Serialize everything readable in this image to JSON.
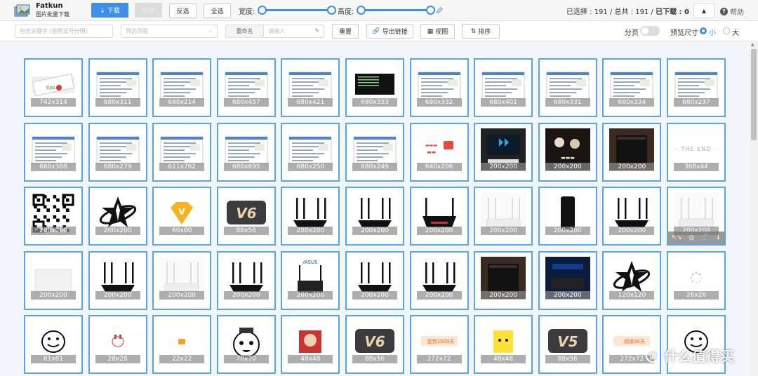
{
  "app": {
    "title": "Fatkun",
    "subtitle": "图片批量下载"
  },
  "toolbar": {
    "download": "↓ 下载",
    "pause": "暂停",
    "invert": "反选",
    "select_all": "全选",
    "width_label": "宽度:",
    "height_label": "高度:",
    "status_prefix": "已选择 : 191 / 总共 : 191 /",
    "status_downloaded": "已下载 : 0",
    "help": "帮助"
  },
  "filters": {
    "keyword_placeholder": "包含关键字 (使用逗号分隔)",
    "page_filter": "筛选页面",
    "rename": "重命名",
    "rename_placeholder": "请输入",
    "reset": "重置",
    "export_links": "导出链接",
    "view": "视图",
    "sort": "排序",
    "paging": "分页",
    "preview_size": "预览尺寸",
    "small": "小",
    "large": "大"
  },
  "tiles": [
    {
      "size": "742x314",
      "kind": "banner"
    },
    {
      "size": "680x311",
      "kind": "doc"
    },
    {
      "size": "680x214",
      "kind": "doc"
    },
    {
      "size": "680x457",
      "kind": "doc"
    },
    {
      "size": "680x421",
      "kind": "doc"
    },
    {
      "size": "680x333",
      "kind": "dark"
    },
    {
      "size": "680x332",
      "kind": "doc"
    },
    {
      "size": "680x401",
      "kind": "doc"
    },
    {
      "size": "680x331",
      "kind": "doc"
    },
    {
      "size": "680x334",
      "kind": "doc"
    },
    {
      "size": "680x237",
      "kind": "doc"
    },
    {
      "size": "680x388",
      "kind": "doc"
    },
    {
      "size": "680x279",
      "kind": "doc"
    },
    {
      "size": "611x762",
      "kind": "doc"
    },
    {
      "size": "680x695",
      "kind": "doc"
    },
    {
      "size": "680x250",
      "kind": "doc"
    },
    {
      "size": "680x249",
      "kind": "doc"
    },
    {
      "size": "640x206",
      "kind": "promo"
    },
    {
      "size": "200x200",
      "kind": "tv"
    },
    {
      "size": "200x200",
      "kind": "poster"
    },
    {
      "size": "200x200",
      "kind": "router-box"
    },
    {
      "size": "368x44",
      "kind": "theend",
      "text": "THE END"
    },
    {
      "size": "200x200",
      "kind": "qr"
    },
    {
      "size": "200x200",
      "kind": "star"
    },
    {
      "size": "60x60",
      "kind": "vgem"
    },
    {
      "size": "88x56",
      "kind": "v6",
      "text": "V6"
    },
    {
      "size": "200x200",
      "kind": "router"
    },
    {
      "size": "200x200",
      "kind": "router"
    },
    {
      "size": "200x200",
      "kind": "router-red"
    },
    {
      "size": "200x200",
      "kind": "router-white"
    },
    {
      "size": "200x200",
      "kind": "tower"
    },
    {
      "size": "200x200",
      "kind": "router"
    },
    {
      "size": "200x200",
      "kind": "router-white",
      "hover": true
    },
    {
      "size": "200x200",
      "kind": "white-box"
    },
    {
      "size": "200x200",
      "kind": "router"
    },
    {
      "size": "200x200",
      "kind": "router-white"
    },
    {
      "size": "200x200",
      "kind": "router"
    },
    {
      "size": "200x200",
      "kind": "router-asus",
      "text": "/ASUS"
    },
    {
      "size": "200x200",
      "kind": "router"
    },
    {
      "size": "200x200",
      "kind": "router"
    },
    {
      "size": "200x200",
      "kind": "router-box"
    },
    {
      "size": "200x200",
      "kind": "router-blue"
    },
    {
      "size": "120x120",
      "kind": "star"
    },
    {
      "size": "26x26",
      "kind": "spinner"
    },
    {
      "size": "61x61",
      "kind": "face"
    },
    {
      "size": "28x28",
      "kind": "bunny"
    },
    {
      "size": "22x22",
      "kind": "coin"
    },
    {
      "size": "70x70",
      "kind": "face2"
    },
    {
      "size": "48x48",
      "kind": "anime"
    },
    {
      "size": "88x56",
      "kind": "v6",
      "text": "V6"
    },
    {
      "size": "272x72",
      "kind": "badge",
      "text": "签到1500天"
    },
    {
      "size": "48x48",
      "kind": "pika"
    },
    {
      "size": "88x56",
      "kind": "v6",
      "text": "V5"
    },
    {
      "size": "272x72",
      "kind": "badge2",
      "text": "阅读30天"
    },
    {
      "size": "",
      "kind": "face"
    }
  ],
  "hover_actions": [
    "↖↘",
    "◎",
    "🔗",
    "↓"
  ],
  "watermark": "什么值得买",
  "colors": {
    "accent": "#3d8fe8",
    "tile_border": "#5aa5e8",
    "gallery_bg": "#f2f6fb"
  }
}
